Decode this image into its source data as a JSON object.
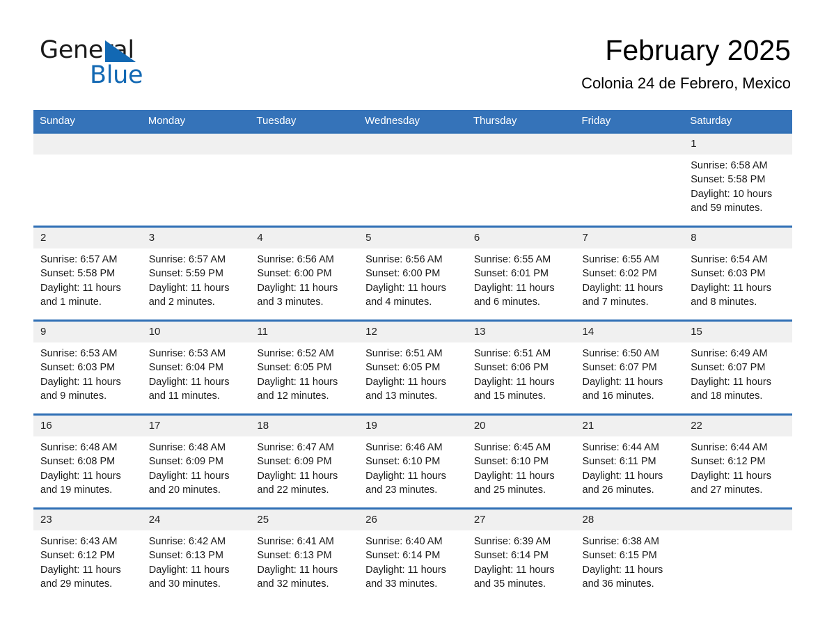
{
  "brand": {
    "logo_line1": "General",
    "logo_line2": "Blue",
    "logo_triangle_color": "#1268b3",
    "logo_text_color": "#1a1a1a"
  },
  "header": {
    "title": "February 2025",
    "subtitle": "Colonia 24 de Febrero, Mexico"
  },
  "colors": {
    "header_row_bg": "#3573b9",
    "row_divider": "#2f6fb5",
    "daynum_bg": "#f0f0f0",
    "cell_bg": "#ffffff",
    "text": "#1a1a1a"
  },
  "calendar": {
    "weekday_headers": [
      "Sunday",
      "Monday",
      "Tuesday",
      "Wednesday",
      "Thursday",
      "Friday",
      "Saturday"
    ],
    "weeks": [
      [
        {
          "day": "",
          "blank": true
        },
        {
          "day": "",
          "blank": true
        },
        {
          "day": "",
          "blank": true
        },
        {
          "day": "",
          "blank": true
        },
        {
          "day": "",
          "blank": true
        },
        {
          "day": "",
          "blank": true
        },
        {
          "day": "1",
          "sunrise": "Sunrise: 6:58 AM",
          "sunset": "Sunset: 5:58 PM",
          "daylight": "Daylight: 10 hours and 59 minutes."
        }
      ],
      [
        {
          "day": "2",
          "sunrise": "Sunrise: 6:57 AM",
          "sunset": "Sunset: 5:58 PM",
          "daylight": "Daylight: 11 hours and 1 minute."
        },
        {
          "day": "3",
          "sunrise": "Sunrise: 6:57 AM",
          "sunset": "Sunset: 5:59 PM",
          "daylight": "Daylight: 11 hours and 2 minutes."
        },
        {
          "day": "4",
          "sunrise": "Sunrise: 6:56 AM",
          "sunset": "Sunset: 6:00 PM",
          "daylight": "Daylight: 11 hours and 3 minutes."
        },
        {
          "day": "5",
          "sunrise": "Sunrise: 6:56 AM",
          "sunset": "Sunset: 6:00 PM",
          "daylight": "Daylight: 11 hours and 4 minutes."
        },
        {
          "day": "6",
          "sunrise": "Sunrise: 6:55 AM",
          "sunset": "Sunset: 6:01 PM",
          "daylight": "Daylight: 11 hours and 6 minutes."
        },
        {
          "day": "7",
          "sunrise": "Sunrise: 6:55 AM",
          "sunset": "Sunset: 6:02 PM",
          "daylight": "Daylight: 11 hours and 7 minutes."
        },
        {
          "day": "8",
          "sunrise": "Sunrise: 6:54 AM",
          "sunset": "Sunset: 6:03 PM",
          "daylight": "Daylight: 11 hours and 8 minutes."
        }
      ],
      [
        {
          "day": "9",
          "sunrise": "Sunrise: 6:53 AM",
          "sunset": "Sunset: 6:03 PM",
          "daylight": "Daylight: 11 hours and 9 minutes."
        },
        {
          "day": "10",
          "sunrise": "Sunrise: 6:53 AM",
          "sunset": "Sunset: 6:04 PM",
          "daylight": "Daylight: 11 hours and 11 minutes."
        },
        {
          "day": "11",
          "sunrise": "Sunrise: 6:52 AM",
          "sunset": "Sunset: 6:05 PM",
          "daylight": "Daylight: 11 hours and 12 minutes."
        },
        {
          "day": "12",
          "sunrise": "Sunrise: 6:51 AM",
          "sunset": "Sunset: 6:05 PM",
          "daylight": "Daylight: 11 hours and 13 minutes."
        },
        {
          "day": "13",
          "sunrise": "Sunrise: 6:51 AM",
          "sunset": "Sunset: 6:06 PM",
          "daylight": "Daylight: 11 hours and 15 minutes."
        },
        {
          "day": "14",
          "sunrise": "Sunrise: 6:50 AM",
          "sunset": "Sunset: 6:07 PM",
          "daylight": "Daylight: 11 hours and 16 minutes."
        },
        {
          "day": "15",
          "sunrise": "Sunrise: 6:49 AM",
          "sunset": "Sunset: 6:07 PM",
          "daylight": "Daylight: 11 hours and 18 minutes."
        }
      ],
      [
        {
          "day": "16",
          "sunrise": "Sunrise: 6:48 AM",
          "sunset": "Sunset: 6:08 PM",
          "daylight": "Daylight: 11 hours and 19 minutes."
        },
        {
          "day": "17",
          "sunrise": "Sunrise: 6:48 AM",
          "sunset": "Sunset: 6:09 PM",
          "daylight": "Daylight: 11 hours and 20 minutes."
        },
        {
          "day": "18",
          "sunrise": "Sunrise: 6:47 AM",
          "sunset": "Sunset: 6:09 PM",
          "daylight": "Daylight: 11 hours and 22 minutes."
        },
        {
          "day": "19",
          "sunrise": "Sunrise: 6:46 AM",
          "sunset": "Sunset: 6:10 PM",
          "daylight": "Daylight: 11 hours and 23 minutes."
        },
        {
          "day": "20",
          "sunrise": "Sunrise: 6:45 AM",
          "sunset": "Sunset: 6:10 PM",
          "daylight": "Daylight: 11 hours and 25 minutes."
        },
        {
          "day": "21",
          "sunrise": "Sunrise: 6:44 AM",
          "sunset": "Sunset: 6:11 PM",
          "daylight": "Daylight: 11 hours and 26 minutes."
        },
        {
          "day": "22",
          "sunrise": "Sunrise: 6:44 AM",
          "sunset": "Sunset: 6:12 PM",
          "daylight": "Daylight: 11 hours and 27 minutes."
        }
      ],
      [
        {
          "day": "23",
          "sunrise": "Sunrise: 6:43 AM",
          "sunset": "Sunset: 6:12 PM",
          "daylight": "Daylight: 11 hours and 29 minutes."
        },
        {
          "day": "24",
          "sunrise": "Sunrise: 6:42 AM",
          "sunset": "Sunset: 6:13 PM",
          "daylight": "Daylight: 11 hours and 30 minutes."
        },
        {
          "day": "25",
          "sunrise": "Sunrise: 6:41 AM",
          "sunset": "Sunset: 6:13 PM",
          "daylight": "Daylight: 11 hours and 32 minutes."
        },
        {
          "day": "26",
          "sunrise": "Sunrise: 6:40 AM",
          "sunset": "Sunset: 6:14 PM",
          "daylight": "Daylight: 11 hours and 33 minutes."
        },
        {
          "day": "27",
          "sunrise": "Sunrise: 6:39 AM",
          "sunset": "Sunset: 6:14 PM",
          "daylight": "Daylight: 11 hours and 35 minutes."
        },
        {
          "day": "28",
          "sunrise": "Sunrise: 6:38 AM",
          "sunset": "Sunset: 6:15 PM",
          "daylight": "Daylight: 11 hours and 36 minutes."
        },
        {
          "day": "",
          "blank": true
        }
      ]
    ]
  }
}
